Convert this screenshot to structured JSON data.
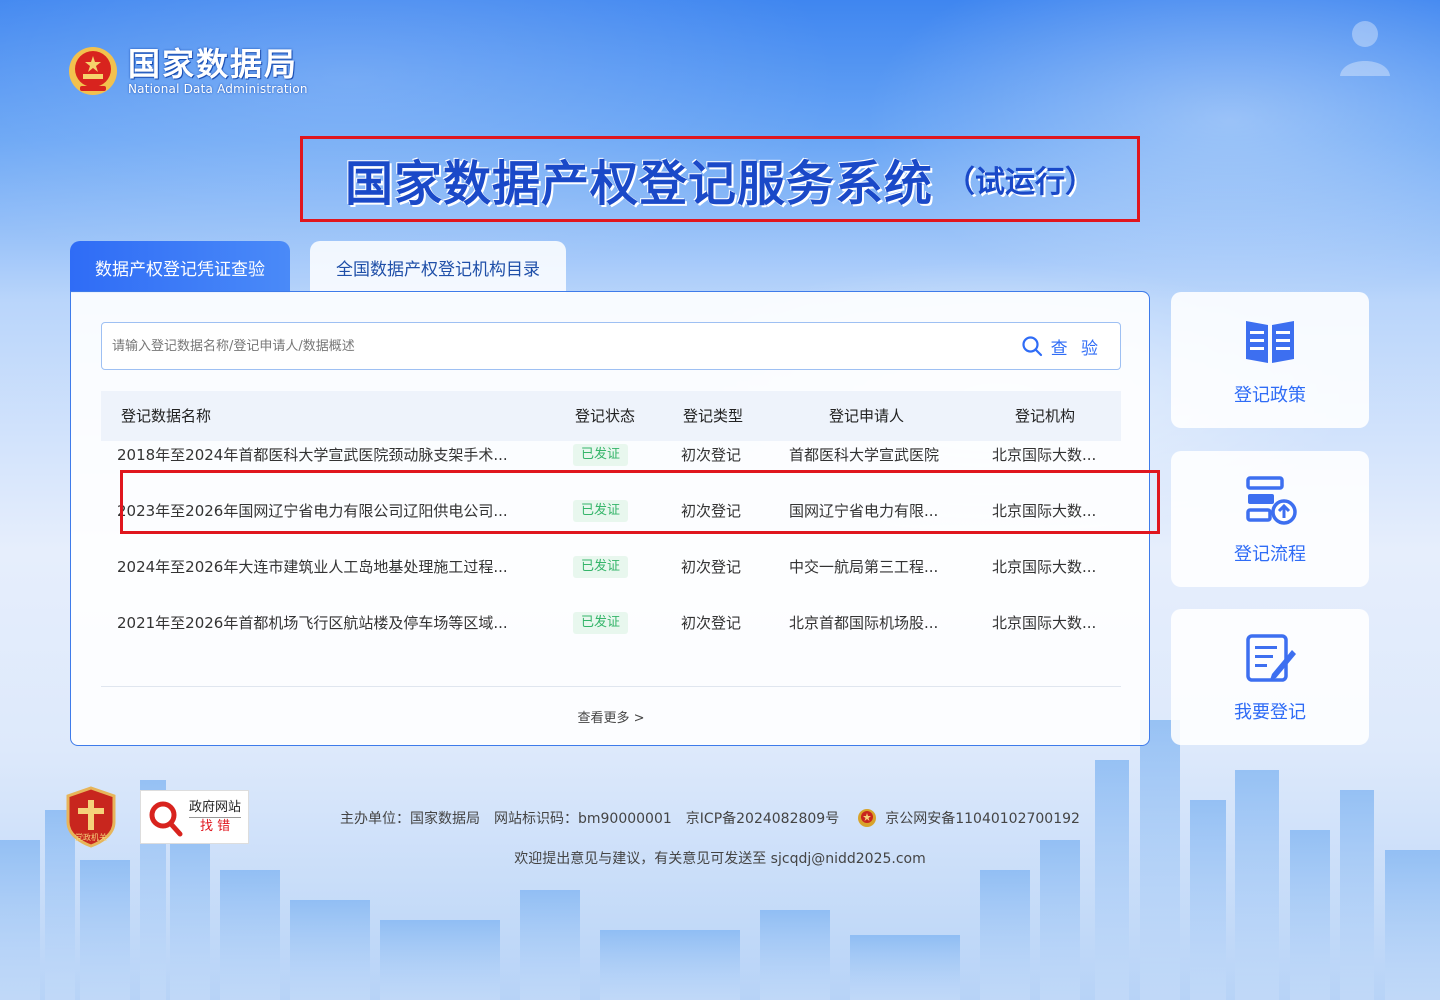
{
  "header": {
    "logo_cn": "国家数据局",
    "logo_en": "National Data Administration",
    "title": "国家数据产权登记服务系统",
    "title_sub": "（试运行）"
  },
  "tabs": [
    {
      "label": "数据产权登记凭证查验",
      "active": true
    },
    {
      "label": "全国数据产权登记机构目录",
      "active": false
    }
  ],
  "search": {
    "placeholder": "请输入登记数据名称/登记申请人/数据概述",
    "value": "",
    "button_label": "查 验"
  },
  "table": {
    "headers": [
      "登记数据名称",
      "登记状态",
      "登记类型",
      "登记申请人",
      "登记机构"
    ],
    "rows": [
      {
        "name": "2018年至2024年首都医科大学宣武医院颈动脉支架手术...",
        "status": "已发证",
        "type": "初次登记",
        "applicant": "首都医科大学宣武医院",
        "agency": "北京国际大数..."
      },
      {
        "name": "2023年至2026年国网辽宁省电力有限公司辽阳供电公司...",
        "status": "已发证",
        "type": "初次登记",
        "applicant": "国网辽宁省电力有限...",
        "agency": "北京国际大数..."
      },
      {
        "name": "2024年至2026年大连市建筑业人工岛地基处理施工过程...",
        "status": "已发证",
        "type": "初次登记",
        "applicant": "中交一航局第三工程...",
        "agency": "北京国际大数..."
      },
      {
        "name": "2021年至2026年首都机场飞行区航站楼及停车场等区域...",
        "status": "已发证",
        "type": "初次登记",
        "applicant": "北京首都国际机场股...",
        "agency": "北京国际大数..."
      }
    ],
    "more_label": "查看更多 >"
  },
  "side": [
    {
      "label": "登记政策",
      "icon": "book-icon"
    },
    {
      "label": "登记流程",
      "icon": "process-icon"
    },
    {
      "label": "我要登记",
      "icon": "edit-icon"
    }
  ],
  "footer": {
    "dj_label": "党政机关",
    "gov_error_l1": "政府网站",
    "gov_error_l2": "找 错",
    "host": "主办单位：国家数据局",
    "site_code": "网站标识码：bm90000001",
    "icp": "京ICP备2024082809号",
    "police": "京公网安备11040102700192",
    "feedback": "欢迎提出意见与建议，有关意见可发送至 sjcqdj@nidd2025.com"
  },
  "colors": {
    "primary": "#2f6cf6",
    "title": "#1a49c8",
    "highlight": "#e0161e",
    "status": "#35b56a"
  }
}
